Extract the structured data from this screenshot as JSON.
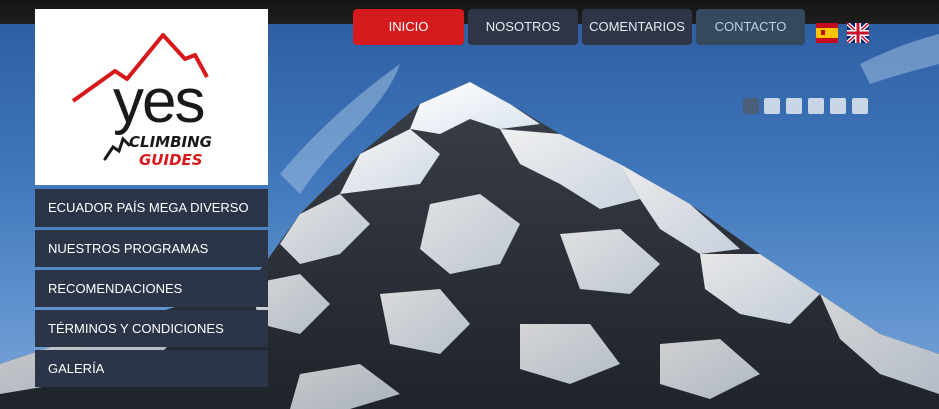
{
  "logo": {
    "brand": "yes",
    "line1": "CLIMBING",
    "line2": "GUIDES",
    "accent_color": "#d7191c"
  },
  "nav": [
    {
      "label": "INICIO",
      "active": true
    },
    {
      "label": "NOSOTROS",
      "active": false
    },
    {
      "label": "COMENTARIOS",
      "active": false
    },
    {
      "label": "CONTACTO",
      "active": false
    }
  ],
  "languages": [
    {
      "code": "es",
      "icon": "spain-flag-icon"
    },
    {
      "code": "en",
      "icon": "uk-flag-icon"
    }
  ],
  "side_menu": [
    "ECUADOR PAÍS MEGA DIVERSO",
    "NUESTROS PROGRAMAS",
    "RECOMENDACIONES",
    "TÉRMINOS Y CONDICIONES",
    "GALERÍA"
  ],
  "slider": {
    "slides": 6,
    "active_index": 0
  },
  "colors": {
    "nav_active": "#d51a1d",
    "nav_bg": "#2e3546",
    "menu_bg": "#2c3547",
    "sky": "#3d74b8"
  }
}
